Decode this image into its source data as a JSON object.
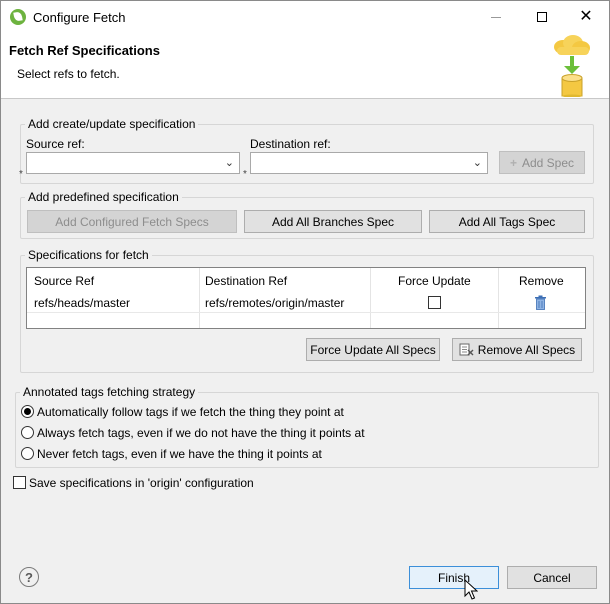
{
  "window": {
    "title": "Configure Fetch",
    "controls": {
      "minimize": "—",
      "maximize": "☐",
      "close": "✕"
    }
  },
  "banner": {
    "title": "Fetch Ref Specifications",
    "description": "Select refs to fetch.",
    "icon": "cloud-to-database-icon"
  },
  "create_group": {
    "label": "Add create/update specification",
    "source_label": "Source ref:",
    "source_value": "",
    "destination_label": "Destination ref:",
    "destination_value": "",
    "required_marker": "*",
    "add_spec_button": "Add Spec"
  },
  "predefined_group": {
    "label": "Add predefined specification",
    "add_configured_button": "Add Configured Fetch Specs",
    "add_branches_button": "Add All Branches Spec",
    "add_tags_button": "Add All Tags Spec"
  },
  "specs_group": {
    "label": "Specifications for fetch",
    "columns": [
      "Source Ref",
      "Destination Ref",
      "Force Update",
      "Remove"
    ],
    "rows": [
      {
        "source": "refs/heads/master",
        "destination": "refs/remotes/origin/master",
        "force_update": false
      }
    ],
    "force_all_button": "Force Update All Specs",
    "remove_all_button": "Remove All Specs"
  },
  "tags_group": {
    "label": "Annotated tags fetching strategy",
    "options": [
      {
        "label": "Automatically follow tags if we fetch the thing they point at",
        "selected": true
      },
      {
        "label": "Always fetch tags, even if we do not have the thing it points at",
        "selected": false
      },
      {
        "label": "Never fetch tags, even if we have the thing it points at",
        "selected": false
      }
    ]
  },
  "save_checkbox": {
    "label": "Save specifications in 'origin' configuration",
    "checked": false
  },
  "footer": {
    "help": "?",
    "finish_button": "Finish",
    "cancel_button": "Cancel"
  }
}
